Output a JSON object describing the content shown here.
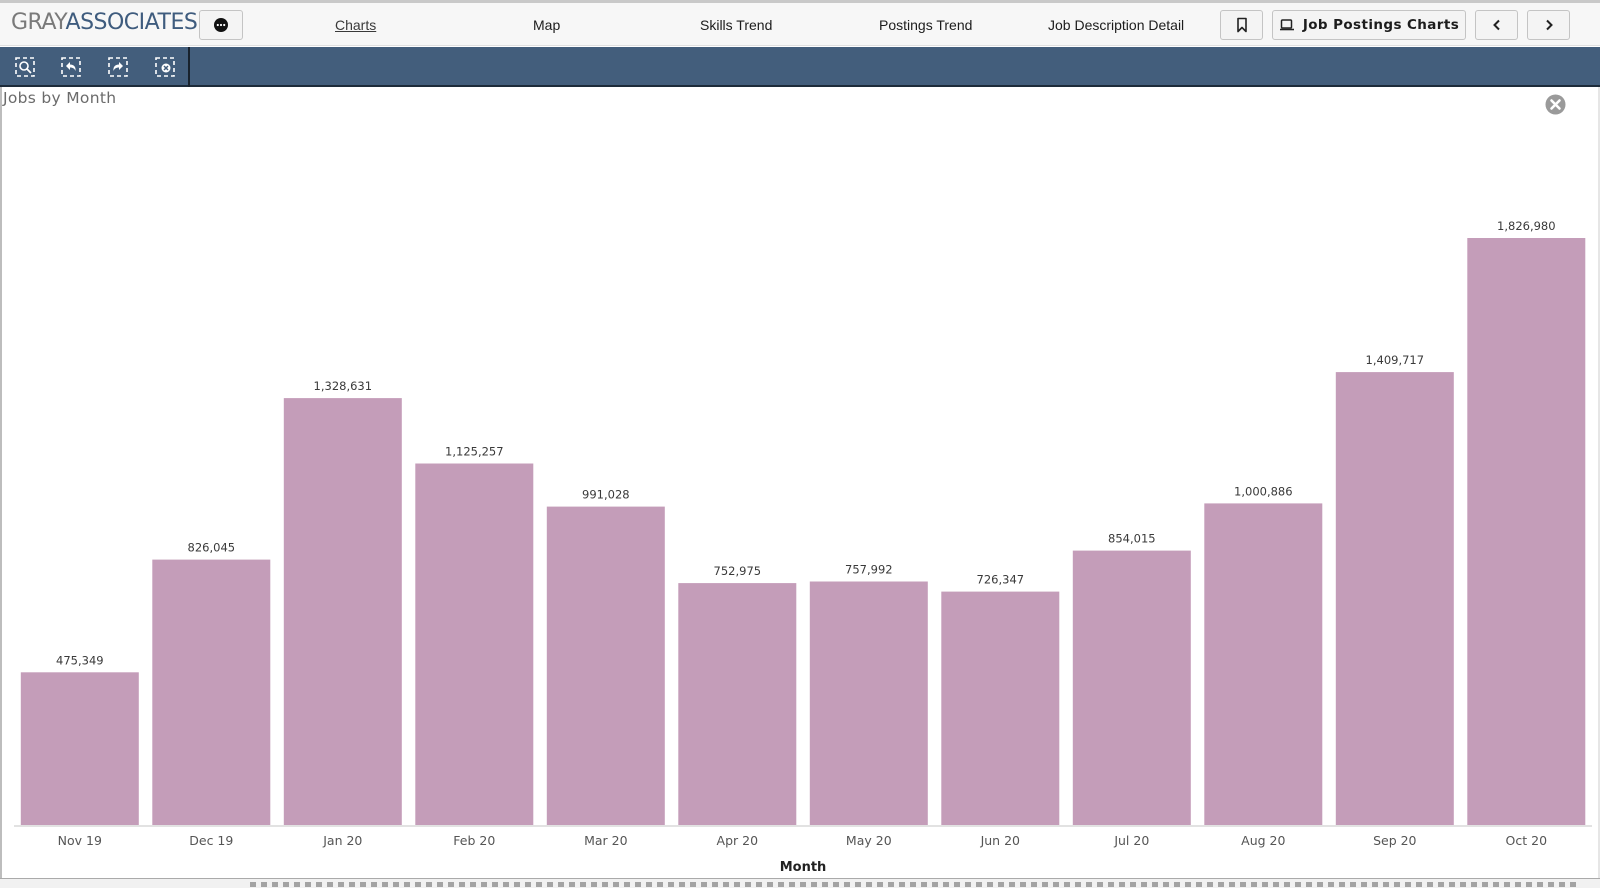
{
  "header": {
    "logo_part1": "GRAY",
    "logo_part2": "ASSOCIATES",
    "more_icon": "more-dots-icon",
    "nav": [
      {
        "label": "Charts",
        "active": true
      },
      {
        "label": "Map",
        "active": false
      },
      {
        "label": "Skills Trend",
        "active": false
      },
      {
        "label": "Postings Trend",
        "active": false
      },
      {
        "label": "Job Description Detail",
        "active": false
      }
    ],
    "bookmark_icon": "bookmark-icon",
    "view_button_icon": "laptop-icon",
    "view_button_label": "Job Postings Charts",
    "prev_icon": "chevron-left-icon",
    "next_icon": "chevron-right-icon"
  },
  "toolbar": {
    "tools": [
      {
        "name": "zoom-selection",
        "icon": "zoom-select-icon"
      },
      {
        "name": "undo-selection",
        "icon": "undo-select-icon"
      },
      {
        "name": "redo-selection",
        "icon": "redo-select-icon"
      },
      {
        "name": "clear-selection",
        "icon": "clear-select-icon"
      }
    ]
  },
  "colors": {
    "bar": "#c49db9",
    "toolbar": "#435e7c",
    "logo_gray": "#7a7a7a",
    "logo_blue": "#3f5c7e"
  },
  "chart_data": {
    "type": "bar",
    "title": "Jobs by Month",
    "xlabel": "Month",
    "ylabel": "",
    "categories": [
      "Nov 19",
      "Dec 19",
      "Jan 20",
      "Feb 20",
      "Mar 20",
      "Apr 20",
      "May 20",
      "Jun 20",
      "Jul 20",
      "Aug 20",
      "Sep 20",
      "Oct 20"
    ],
    "values": [
      475349,
      826045,
      1328631,
      1125257,
      991028,
      752975,
      757992,
      726347,
      854015,
      1000886,
      1409717,
      1826980
    ],
    "value_labels": [
      "475,349",
      "826,045",
      "1,328,631",
      "1,125,257",
      "991,028",
      "752,975",
      "757,992",
      "726,347",
      "854,015",
      "1,000,886",
      "1,409,717",
      "1,826,980"
    ],
    "ylim": [
      0,
      1826980
    ],
    "grid": false,
    "legend": "none",
    "y_axis_visible": false
  }
}
